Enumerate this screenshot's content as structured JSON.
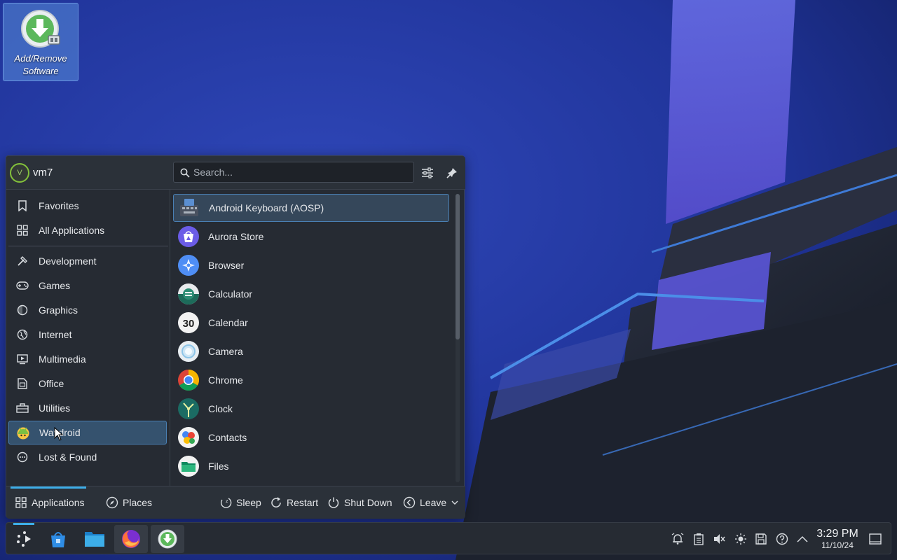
{
  "desktop": {
    "icon_label_line1": "Add/Remove",
    "icon_label_line2": "Software"
  },
  "launcher": {
    "username": "vm7",
    "avatar_letter": "V",
    "search_placeholder": "Search...",
    "sidebar": [
      {
        "label": "Favorites",
        "icon": "bookmark-icon"
      },
      {
        "label": "All Applications",
        "icon": "grid-icon"
      },
      {
        "label": "Development",
        "icon": "hammer-icon"
      },
      {
        "label": "Games",
        "icon": "gamepad-icon"
      },
      {
        "label": "Graphics",
        "icon": "palette-icon"
      },
      {
        "label": "Internet",
        "icon": "globe-icon"
      },
      {
        "label": "Multimedia",
        "icon": "media-icon"
      },
      {
        "label": "Office",
        "icon": "document-icon"
      },
      {
        "label": "Utilities",
        "icon": "toolbox-icon"
      },
      {
        "label": "Waydroid",
        "icon": "android-icon",
        "active": true
      },
      {
        "label": "Lost & Found",
        "icon": "ellipsis-icon"
      }
    ],
    "apps": [
      {
        "label": "Android Keyboard (AOSP)",
        "icon": "keyboard-icon",
        "active": true
      },
      {
        "label": "Aurora Store",
        "icon": "aurora-store-icon"
      },
      {
        "label": "Browser",
        "icon": "browser-icon"
      },
      {
        "label": "Calculator",
        "icon": "calculator-icon"
      },
      {
        "label": "Calendar",
        "icon": "calendar-icon",
        "badge": "30"
      },
      {
        "label": "Camera",
        "icon": "camera-icon"
      },
      {
        "label": "Chrome",
        "icon": "chrome-icon"
      },
      {
        "label": "Clock",
        "icon": "clock-icon"
      },
      {
        "label": "Contacts",
        "icon": "contacts-icon"
      },
      {
        "label": "Files",
        "icon": "files-icon"
      }
    ],
    "footer": {
      "applications": "Applications",
      "places": "Places",
      "sleep": "Sleep",
      "restart": "Restart",
      "shutdown": "Shut Down",
      "leave": "Leave"
    }
  },
  "taskbar": {
    "time": "3:29 PM",
    "date": "11/10/24"
  },
  "colors": {
    "accent": "#3daee9",
    "panel": "#262b33",
    "selection": "#35526e"
  }
}
